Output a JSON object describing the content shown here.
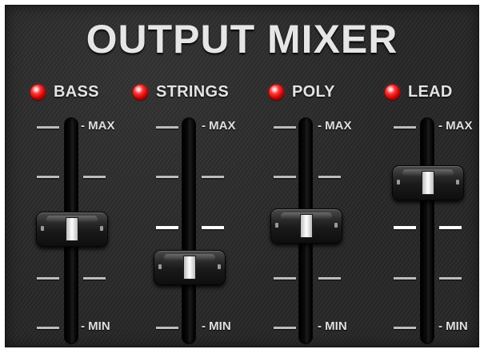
{
  "title": "OUTPUT MIXER",
  "scale": {
    "max": "MAX",
    "min": "MIN"
  },
  "channels": [
    {
      "name": "BASS",
      "led": "red",
      "level": 0.5
    },
    {
      "name": "STRINGS",
      "led": "red",
      "level": 0.3
    },
    {
      "name": "POLY",
      "led": "red",
      "level": 0.5
    },
    {
      "name": "LEAD",
      "led": "red",
      "level": 0.75
    }
  ],
  "colors": {
    "led": "#ff2a2a",
    "panel": "#2a2a2a",
    "text": "#e6e6e6"
  },
  "icons": {
    "led": "led-indicator-icon",
    "fader": "fader-knob-icon"
  }
}
